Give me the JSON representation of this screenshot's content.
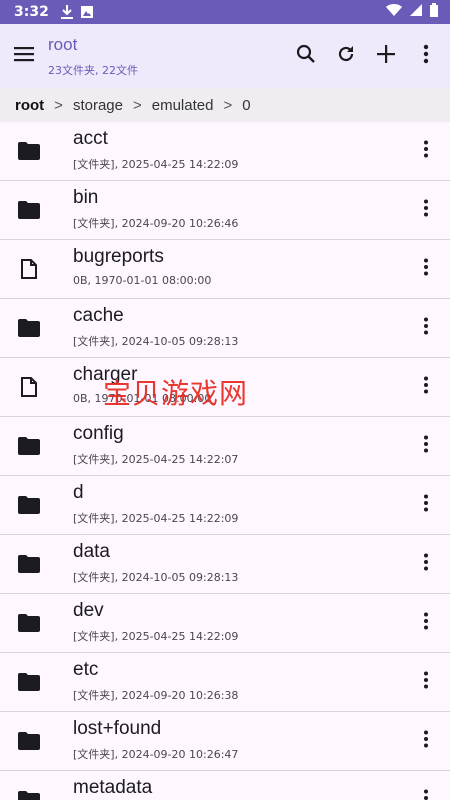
{
  "status_bar": {
    "time": "3:32",
    "icons_left": [
      "download-icon",
      "image-icon"
    ],
    "icons_right": [
      "wifi-icon",
      "signal-icon",
      "battery-icon"
    ]
  },
  "appbar": {
    "title": "root",
    "subtitle": "23文件夹, 22文件",
    "actions": [
      "search-icon",
      "refresh-icon",
      "add-icon",
      "more-vert-icon"
    ]
  },
  "breadcrumb": {
    "segments": [
      "root",
      "storage",
      "emulated",
      "0"
    ],
    "separator": ">"
  },
  "files": [
    {
      "name": "acct",
      "meta": "[文件夹], 2025-04-25 14:22:09",
      "type": "folder"
    },
    {
      "name": "bin",
      "meta": "[文件夹], 2024-09-20 10:26:46",
      "type": "folder"
    },
    {
      "name": "bugreports",
      "meta": "0B, 1970-01-01 08:00:00",
      "type": "file"
    },
    {
      "name": "cache",
      "meta": "[文件夹], 2024-10-05 09:28:13",
      "type": "folder"
    },
    {
      "name": "charger",
      "meta": "0B, 1970-01-01 08:00:00",
      "type": "file"
    },
    {
      "name": "config",
      "meta": "[文件夹], 2025-04-25 14:22:07",
      "type": "folder"
    },
    {
      "name": "d",
      "meta": "[文件夹], 2025-04-25 14:22:09",
      "type": "folder"
    },
    {
      "name": "data",
      "meta": "[文件夹], 2024-10-05 09:28:13",
      "type": "folder"
    },
    {
      "name": "dev",
      "meta": "[文件夹], 2025-04-25 14:22:09",
      "type": "folder"
    },
    {
      "name": "etc",
      "meta": "[文件夹], 2024-09-20 10:26:38",
      "type": "folder"
    },
    {
      "name": "lost+found",
      "meta": "[文件夹], 2024-09-20 10:26:47",
      "type": "folder"
    },
    {
      "name": "metadata",
      "meta": "",
      "type": "folder"
    }
  ],
  "watermark": "宝贝游戏网",
  "colors": {
    "status_bar": "#6b5bb8",
    "appbar_bg": "#f0e9fb",
    "accent": "#6b5bb8",
    "list_bg": "#fef7ff",
    "watermark": "#e8281f"
  }
}
